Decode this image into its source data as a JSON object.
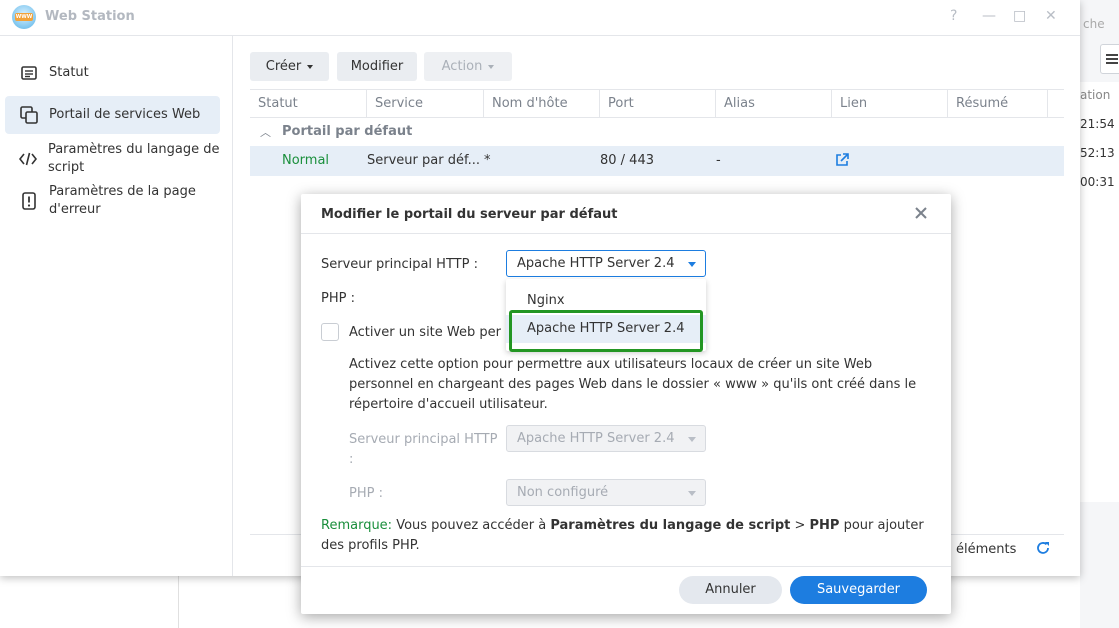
{
  "background": {
    "search_hint": "che",
    "column_header": "ation",
    "times": [
      "21:54",
      "52:13",
      "00:31"
    ]
  },
  "window": {
    "title": "Web Station",
    "controls": {
      "help": "?",
      "minimize": "—",
      "maximize": "□",
      "close": "✕"
    }
  },
  "sidebar": {
    "items": [
      {
        "label": "Statut",
        "icon": "list-icon",
        "active": false
      },
      {
        "label": "Portail de services Web",
        "icon": "portal-icon",
        "active": true
      },
      {
        "label": "Paramètres du langage de script",
        "icon": "code-icon",
        "active": false
      },
      {
        "label": "Paramètres de la page d'erreur",
        "icon": "error-icon",
        "active": false
      }
    ]
  },
  "toolbar": {
    "create": "Créer",
    "modify": "Modifier",
    "action": "Action"
  },
  "table": {
    "columns": [
      "Statut",
      "Service",
      "Nom d'hôte",
      "Port",
      "Alias",
      "Lien",
      "Résumé"
    ],
    "group": "Portail par défaut",
    "rows": [
      {
        "status": "Normal",
        "service": "Serveur par déf...",
        "hostname": "*",
        "port": "80 / 443",
        "alias": "-",
        "link": "external-link-icon",
        "summary": ""
      }
    ],
    "footer_count": "éléments"
  },
  "dialog": {
    "title": "Modifier le portail du serveur par défaut",
    "http_label": "Serveur principal HTTP :",
    "http_value": "Apache HTTP Server 2.4",
    "php_label": "PHP :",
    "checkbox_label": "Activer un site Web per",
    "description": "Activez cette option pour permettre aux utilisateurs locaux de créer un site Web personnel en chargeant des pages Web dans le dossier « www » qu'ils ont créé dans le répertoire d'accueil utilisateur.",
    "sub_http_label_1": "Serveur principal HTTP",
    "sub_http_label_2": ":",
    "sub_http_value": "Apache HTTP Server 2.4",
    "sub_php_label": "PHP :",
    "sub_php_value": "Non configuré",
    "remark_prefix": "Remarque:",
    "remark_text1": " Vous pouvez accéder à ",
    "remark_bold1": "Paramètres du langage de script",
    "remark_text2": " > ",
    "remark_bold2": "PHP",
    "remark_text3": " pour ajouter des profils PHP.",
    "cancel": "Annuler",
    "save": "Sauvegarder",
    "dropdown_options": [
      "Nginx",
      "Apache HTTP Server 2.4"
    ]
  },
  "colors": {
    "accent": "#1d7de0",
    "status_normal": "#1a8f3c",
    "highlight_border": "#239623",
    "selection_bg": "#e6eef7"
  }
}
